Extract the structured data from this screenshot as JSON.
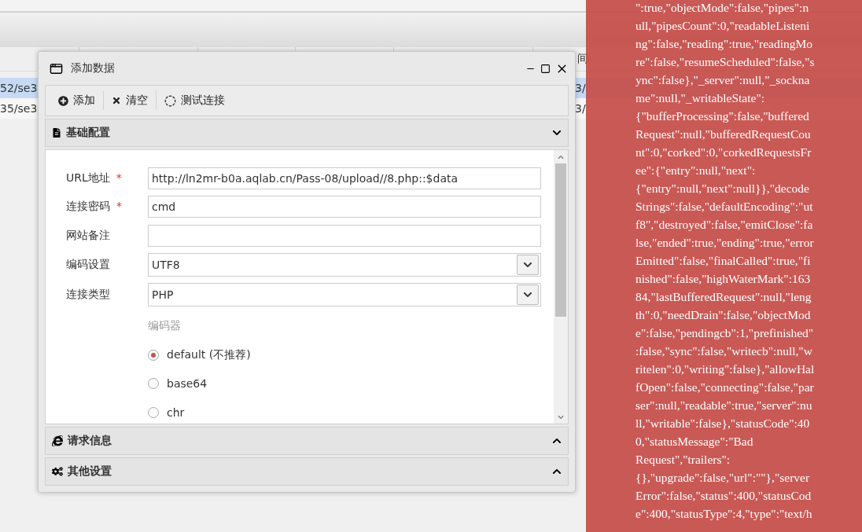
{
  "background_table": {
    "header_cell": "间",
    "rows": [
      {
        "column_1": "52/se3",
        "column_2": "3/",
        "selected": true
      },
      {
        "column_1": "35/se3",
        "column_2": "3/",
        "selected": false
      }
    ]
  },
  "dialog": {
    "title": "添加数据",
    "toolbar": [
      {
        "label": "添加",
        "kind": "add"
      },
      {
        "label": "清空",
        "kind": "clear"
      },
      {
        "label": "测试连接",
        "kind": "test"
      }
    ],
    "basic_section": {
      "title": "基础配置",
      "expanded": true,
      "fields": [
        {
          "label": "URL地址",
          "required_mark": "*",
          "kind": "text",
          "value": "http://ln2mr-b0a.aqlab.cn/Pass-08/upload//8.php::$data"
        },
        {
          "label": "连接密码",
          "required_mark": "*",
          "kind": "text",
          "value": "cmd"
        },
        {
          "label": "网站备注",
          "kind": "text"
        },
        {
          "label": "编码设置",
          "kind": "select",
          "value": "UTF8"
        },
        {
          "label": "连接类型",
          "kind": "select",
          "value": "PHP"
        }
      ],
      "encoder": {
        "label": "编码器",
        "options": [
          {
            "label": "default (不推荐)",
            "selected": true
          },
          {
            "label": "base64",
            "selected": false
          },
          {
            "label": "chr",
            "selected": false
          }
        ]
      }
    },
    "other_sections": [
      {
        "title": "请求信息",
        "kind": "request",
        "expanded": false
      },
      {
        "title": "其他设置",
        "kind": "settings",
        "expanded": false
      }
    ]
  },
  "log_overlay": {
    "lines": [
      "\":true,\"objectMode\":false,\"pipes\":n",
      "ull,\"pipesCount\":0,\"readableListeni",
      "ng\":false,\"reading\":true,\"readingMo",
      "re\":false,\"resumeScheduled\":false,\"s",
      "ync\":false},\"_server\":null,\"_sockna",
      "me\":null,\"_writableState\":",
      "{\"bufferProcessing\":false,\"buffered",
      "Request\":null,\"bufferedRequestCou",
      "nt\":0,\"corked\":0,\"corkedRequestsFr",
      "ee\":{\"entry\":null,\"next\":",
      "{\"entry\":null,\"next\":null}},\"decode",
      "Strings\":false,\"defaultEncoding\":\"ut",
      "f8\",\"destroyed\":false,\"emitClose\":fa",
      "lse,\"ended\":true,\"ending\":true,\"error",
      "Emitted\":false,\"finalCalled\":true,\"fi",
      "nished\":false,\"highWaterMark\":163",
      "84,\"lastBufferedRequest\":null,\"leng",
      "th\":0,\"needDrain\":false,\"objectMod",
      "e\":false,\"pendingcb\":1,\"prefinished\"",
      ":false,\"sync\":false,\"writecb\":null,\"w",
      "ritelen\":0,\"writing\":false},\"allowHal",
      "fOpen\":false,\"connecting\":false,\"par",
      "ser\":null,\"readable\":true,\"server\":nu",
      "ll,\"writable\":false},\"statusCode\":40",
      "0,\"statusMessage\":\"Bad",
      "Request\",\"trailers\":",
      "{},\"upgrade\":false,\"url\":\"\"},\"server",
      "Error\":false,\"status\":400,\"statusCod",
      "e\":400,\"statusType\":4,\"type\":\"text/h"
    ]
  }
}
